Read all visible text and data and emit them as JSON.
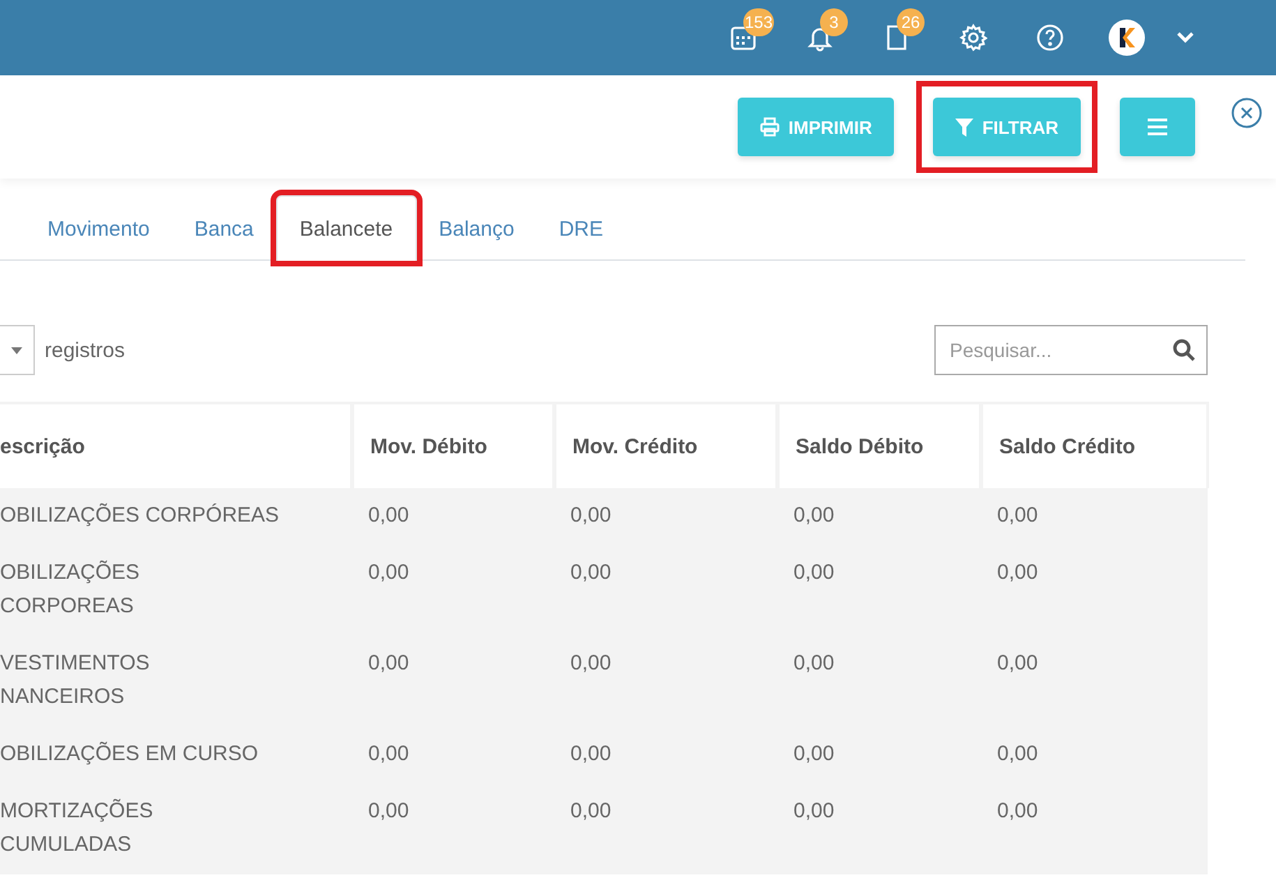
{
  "top_bar": {
    "icons": [
      {
        "kind": "calendar",
        "badge": "153"
      },
      {
        "kind": "bell",
        "badge": "3"
      },
      {
        "kind": "document",
        "badge": "26"
      },
      {
        "kind": "gear"
      },
      {
        "kind": "help"
      },
      {
        "kind": "avatar"
      },
      {
        "kind": "caret"
      }
    ]
  },
  "toolbar": {
    "buttons": [
      {
        "kind": "print",
        "label": "IMPRIMIR",
        "highlighted": false
      },
      {
        "kind": "filter",
        "label": "FILTRAR",
        "highlighted": true
      },
      {
        "kind": "menu",
        "highlighted": false
      }
    ]
  },
  "tabs": [
    {
      "label": "Movimento",
      "selected": false,
      "highlighted": false
    },
    {
      "label": "Banca",
      "selected": false,
      "highlighted": false
    },
    {
      "label": "Balancete",
      "selected": true,
      "highlighted": true
    },
    {
      "label": "Balanço",
      "selected": false,
      "highlighted": false
    },
    {
      "label": "DRE",
      "selected": false,
      "highlighted": false
    }
  ],
  "length_control": {
    "label": "registros"
  },
  "search": {
    "placeholder": "Pesquisar..."
  },
  "table": {
    "columns": [
      "escrição",
      "Mov. Débito",
      "Mov. Crédito",
      "Saldo Débito",
      "Saldo Crédito"
    ],
    "rows": [
      [
        "OBILIZAÇÕES CORPÓREAS",
        "0,00",
        "0,00",
        "0,00",
        "0,00"
      ],
      [
        "OBILIZAÇÕES\nCORPOREAS",
        "0,00",
        "0,00",
        "0,00",
        "0,00"
      ],
      [
        "VESTIMENTOS\nNANCEIROS",
        "0,00",
        "0,00",
        "0,00",
        "0,00"
      ],
      [
        "OBILIZAÇÕES EM CURSO",
        "0,00",
        "0,00",
        "0,00",
        "0,00"
      ],
      [
        "MORTIZAÇÕES\nCUMULADAS",
        "0,00",
        "0,00",
        "0,00",
        "0,00"
      ]
    ]
  }
}
